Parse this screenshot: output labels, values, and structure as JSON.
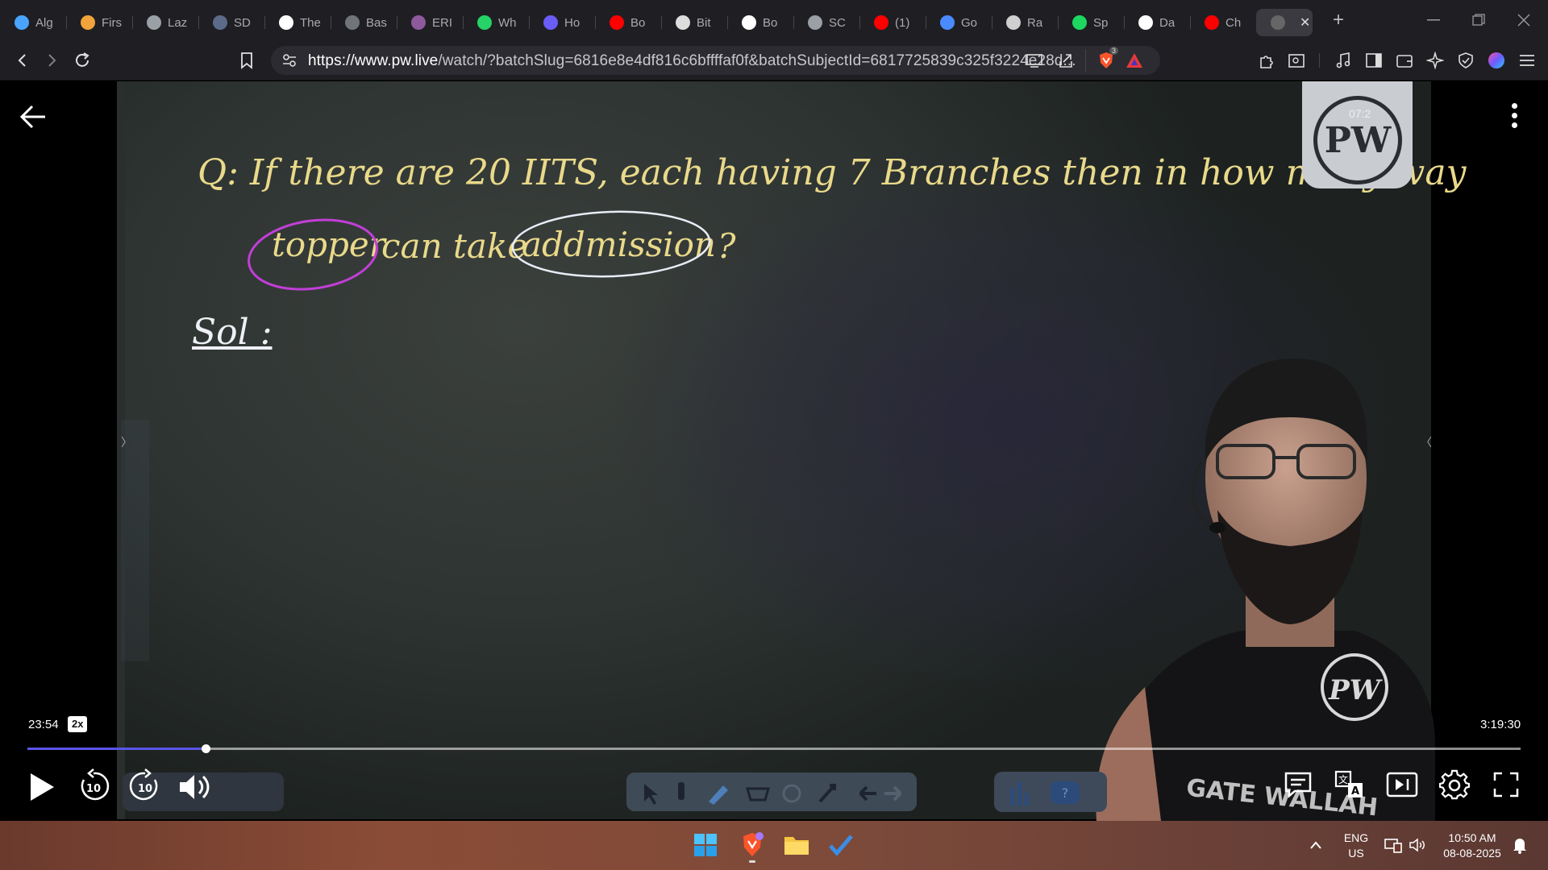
{
  "browser": {
    "tabs": [
      {
        "title": "Alg",
        "icon": "copilot-icon",
        "color": "#4aa4ff"
      },
      {
        "title": "Firs",
        "icon": "bolt-icon",
        "color": "#f2a33c"
      },
      {
        "title": "Laz",
        "icon": "globe-icon",
        "color": "#9aa0a6"
      },
      {
        "title": "SD",
        "icon": "sd-icon",
        "color": "#5c6b8a"
      },
      {
        "title": "The",
        "icon": "w3-icon",
        "color": "#ffffff"
      },
      {
        "title": "Bas",
        "icon": "grid-icon",
        "color": "#70757a"
      },
      {
        "title": "ERI",
        "icon": "brain-icon",
        "color": "#8e5a9c"
      },
      {
        "title": "Wh",
        "icon": "whatsapp-icon",
        "color": "#25d366"
      },
      {
        "title": "Ho",
        "icon": "bookmark-icon",
        "color": "#6a5cf5"
      },
      {
        "title": "Bo",
        "icon": "youtube-icon",
        "color": "#ff0000"
      },
      {
        "title": "Bit",
        "icon": "bitly-icon",
        "color": "#dddddd"
      },
      {
        "title": "Bo",
        "icon": "google-icon",
        "color": "#ffffff"
      },
      {
        "title": "SC",
        "icon": "globe-icon",
        "color": "#9aa0a6"
      },
      {
        "title": "(1)",
        "icon": "youtube-icon",
        "color": "#ff0000"
      },
      {
        "title": "Go",
        "icon": "gemini-icon",
        "color": "#4a8cff"
      },
      {
        "title": "Ra",
        "icon": "openai-icon",
        "color": "#cfcfcf"
      },
      {
        "title": "Sp",
        "icon": "spotify-icon",
        "color": "#1ed760"
      },
      {
        "title": "Da",
        "icon": "wikipedia-icon",
        "color": "#ffffff"
      },
      {
        "title": "Ch",
        "icon": "youtube-icon",
        "color": "#ff0000"
      }
    ],
    "new_tab": "+",
    "url_host": "https://www.pw.live",
    "url_rest": "/watch/?batchSlug=6816e8e4df816c6bffffaf0f&batchSubjectId=6817725839c325f3224e28d...",
    "brave_shield_count": "3"
  },
  "lecture": {
    "line1": "Q:  If there are 20 IITS, each having 7 Branches then in how many way",
    "line2a": "topper",
    "line2b": "can take",
    "line2c": "addmission",
    "line2d": "?",
    "sol": "Sol :",
    "logo_letters": "PW",
    "logo_time": "07:2",
    "shirt_text": "GATE WALLAH"
  },
  "player": {
    "current_time": "23:54",
    "speed": "2x",
    "duration": "3:19:30",
    "progress": 0.1196,
    "rewind_label": "10",
    "forward_label": "10"
  },
  "taskbar": {
    "lang1": "ENG",
    "lang2": "US",
    "time": "10:50 AM",
    "date": "08-08-2025"
  },
  "colors": {
    "accent_progress": "#5a55e8",
    "chalk_yellow": "#e9d98a",
    "circle_magenta": "#c13fd6",
    "circle_white": "#e8ecf5"
  }
}
